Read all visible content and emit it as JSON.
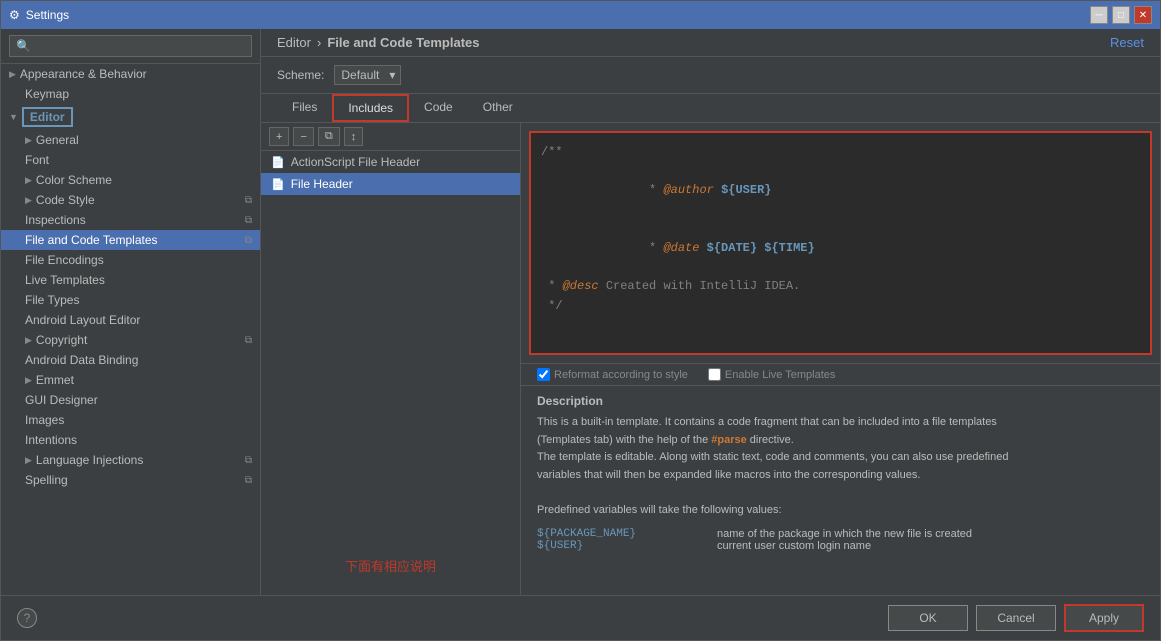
{
  "window": {
    "title": "Settings"
  },
  "header": {
    "breadcrumb_editor": "Editor",
    "breadcrumb_sep": "›",
    "breadcrumb_current": "File and Code Templates",
    "reset_label": "Reset"
  },
  "scheme": {
    "label": "Scheme:",
    "value": "Default"
  },
  "tabs": [
    {
      "id": "files",
      "label": "Files",
      "active": false
    },
    {
      "id": "includes",
      "label": "Includes",
      "active": true,
      "highlighted": true
    },
    {
      "id": "code",
      "label": "Code",
      "active": false
    },
    {
      "id": "other",
      "label": "Other",
      "active": false
    }
  ],
  "toolbar": {
    "add": "+",
    "remove": "−",
    "copy": "⧉",
    "move": "↕"
  },
  "templates": [
    {
      "id": "actionscript",
      "label": "ActionScript File Header",
      "selected": false
    },
    {
      "id": "fileheader",
      "label": "File Header",
      "selected": true
    }
  ],
  "code": {
    "lines": [
      {
        "text": "/**",
        "type": "comment"
      },
      {
        "text": " * @author ",
        "type": "comment",
        "var": "${USER}",
        "var_type": "var"
      },
      {
        "text": " * @date ",
        "type": "comment",
        "var": "${DATE} ${TIME}",
        "var_type": "var"
      },
      {
        "text": " * @desc Created with IntelliJ IDEA.",
        "type": "comment"
      },
      {
        "text": " */",
        "type": "comment"
      }
    ]
  },
  "options": {
    "reformat": "Reformat according to style",
    "live_templates": "Enable Live Templates"
  },
  "description": {
    "title": "Description",
    "text1": "This is a built-in template. It contains a code fragment that can be included into a file templates",
    "text2": "(Templates tab) with the help of the #parse directive.",
    "text3": "The template is editable. Along with static text, code and comments, you can also use predefined",
    "text4": "variables that will then be expanded like macros into the corresponding values.",
    "text5": "Predefined variables will take the following values:",
    "vars": [
      {
        "key": "${PACKAGE_NAME}",
        "desc": "name of the package in which the new file is created"
      },
      {
        "key": "${USER}",
        "desc": "current user custom login name"
      }
    ]
  },
  "sidebar": {
    "search_placeholder": "🔍",
    "items": [
      {
        "label": "Appearance & Behavior",
        "level": 0,
        "has_arrow": true,
        "id": "appearance"
      },
      {
        "label": "Keymap",
        "level": 1,
        "id": "keymap"
      },
      {
        "label": "Editor",
        "level": 0,
        "has_arrow": true,
        "id": "editor",
        "selected_section": true
      },
      {
        "label": "General",
        "level": 1,
        "has_arrow": true,
        "id": "general"
      },
      {
        "label": "Font",
        "level": 1,
        "id": "font"
      },
      {
        "label": "Color Scheme",
        "level": 1,
        "has_arrow": true,
        "id": "colorscheme"
      },
      {
        "label": "Code Style",
        "level": 1,
        "has_arrow": true,
        "id": "codestyle",
        "has_copy": true
      },
      {
        "label": "Inspections",
        "level": 1,
        "id": "inspections",
        "has_copy": true
      },
      {
        "label": "File and Code Templates",
        "level": 1,
        "id": "filecodetemplates",
        "selected": true,
        "has_copy": true
      },
      {
        "label": "File Encodings",
        "level": 1,
        "id": "fileencodings"
      },
      {
        "label": "Live Templates",
        "level": 1,
        "id": "livetemplates"
      },
      {
        "label": "File Types",
        "level": 1,
        "id": "filetypes"
      },
      {
        "label": "Android Layout Editor",
        "level": 1,
        "id": "androidlayout"
      },
      {
        "label": "Copyright",
        "level": 1,
        "has_arrow": true,
        "id": "copyright",
        "has_copy": true
      },
      {
        "label": "Android Data Binding",
        "level": 1,
        "id": "androiddatabinding"
      },
      {
        "label": "Emmet",
        "level": 1,
        "has_arrow": true,
        "id": "emmet"
      },
      {
        "label": "GUI Designer",
        "level": 1,
        "id": "guidesigner"
      },
      {
        "label": "Images",
        "level": 1,
        "id": "images"
      },
      {
        "label": "Intentions",
        "level": 1,
        "id": "intentions"
      },
      {
        "label": "Language Injections",
        "level": 1,
        "has_arrow": true,
        "id": "langinjections",
        "has_copy": true
      },
      {
        "label": "Spelling",
        "level": 1,
        "id": "spelling",
        "has_copy": true
      }
    ]
  },
  "footer": {
    "ok_label": "OK",
    "cancel_label": "Cancel",
    "apply_label": "Apply",
    "help_label": "?"
  },
  "annotation": {
    "chinese_note": "下面有相应说明"
  },
  "colors": {
    "accent": "#4b6eaf",
    "red": "#c0392b",
    "bg_main": "#3c3f41",
    "bg_editor": "#2b2b2b"
  }
}
